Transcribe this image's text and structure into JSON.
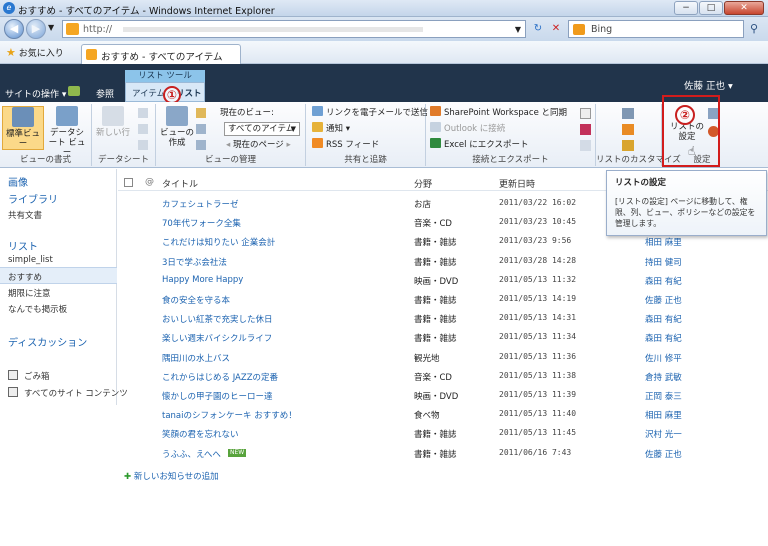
{
  "window": {
    "title": "おすすめ - すべてのアイテム - Windows Internet Explorer",
    "min": "−",
    "max": "□",
    "close": "✕"
  },
  "address": {
    "url": "http://",
    "refresh": "↻",
    "stop": "✕",
    "search_placeholder": "Bing"
  },
  "favorites": {
    "label": "お気に入り",
    "tab_title": "おすすめ - すべてのアイテム"
  },
  "sp": {
    "site_actions": "サイトの操作 ▾",
    "browse": "参照",
    "context_group": "リスト ツール",
    "tab_items": "アイテム",
    "tab_list": "リスト",
    "user": "佐藤 正也 ▾"
  },
  "ribbon": {
    "view_format": {
      "label": "ビューの書式",
      "standard": "標準ビュー",
      "datasheet": "データシート ビュー"
    },
    "datasheet": {
      "label": "データシート",
      "new_row": "新しい行"
    },
    "manage_views": {
      "label": "ビューの管理",
      "create": "ビューの 作成",
      "current_view": "現在のビュー:",
      "view_value": "すべてのアイテム",
      "current_page": "現在のページ"
    },
    "share": {
      "label": "共有と追跡",
      "email_link": "リンクを電子メールで送信",
      "alert": "通知",
      "rss": "RSS フィード"
    },
    "connect": {
      "label": "接続とエクスポート",
      "workspace": "SharePoint Workspace と同期",
      "outlook": "Outlook に接続",
      "excel": "Excel にエクスポート"
    },
    "customize": {
      "label": "リストのカスタマイズ"
    },
    "settings": {
      "label": "設定",
      "list_settings": "リストの 設定"
    }
  },
  "markers": {
    "one": "①",
    "two": "②"
  },
  "leftnav": {
    "pictures": "画像",
    "libraries": "ライブラリ",
    "shared_docs": "共有文書",
    "lists": "リスト",
    "simple_list": "simple_list",
    "osusume": "おすすめ",
    "kijitsu": "期限に注意",
    "keijiban": "なんでも掲示板",
    "discussion": "ディスカッション",
    "recycle": "ごみ箱",
    "all_content": "すべてのサイト コンテンツ"
  },
  "list": {
    "headers": {
      "title": "タイトル",
      "category": "分野",
      "modified": "更新日時"
    },
    "rows": [
      {
        "title": "カフェシュトラーゼ",
        "category": "お店",
        "date": "2011/03/22 16:02",
        "person": ""
      },
      {
        "title": "70年代フォーク全集",
        "category": "音楽・CD",
        "date": "2011/03/23 10:45",
        "person": ""
      },
      {
        "title": "これだけは知りたい 企業会計",
        "category": "書籍・雑誌",
        "date": "2011/03/23 9:56",
        "person": "相田 麻里"
      },
      {
        "title": "3日で学ぶ会社法",
        "category": "書籍・雑誌",
        "date": "2011/03/28 14:28",
        "person": "持田 健司"
      },
      {
        "title": "Happy More Happy",
        "category": "映画・DVD",
        "date": "2011/05/13 11:32",
        "person": "森田 有紀"
      },
      {
        "title": "食の安全を守る本",
        "category": "書籍・雑誌",
        "date": "2011/05/13 14:19",
        "person": "佐藤 正也"
      },
      {
        "title": "おいしい紅茶で充実した休日",
        "category": "書籍・雑誌",
        "date": "2011/05/13 14:31",
        "person": "森田 有紀"
      },
      {
        "title": "楽しい週末バイシクルライフ",
        "category": "書籍・雑誌",
        "date": "2011/05/13 11:34",
        "person": "森田 有紀"
      },
      {
        "title": "隅田川の水上バス",
        "category": "観光地",
        "date": "2011/05/13 11:36",
        "person": "佐川 修平"
      },
      {
        "title": "これからはじめる JAZZの定番",
        "category": "音楽・CD",
        "date": "2011/05/13 11:38",
        "person": "倉持 武敏"
      },
      {
        "title": "懐かしの甲子園のヒーロー達",
        "category": "映画・DVD",
        "date": "2011/05/13 11:39",
        "person": "正岡 泰三"
      },
      {
        "title": "tanaiのシフォンケーキ おすすめ！",
        "category": "食べ物",
        "date": "2011/05/13 11:40",
        "person": "相田 麻里"
      },
      {
        "title": "笑顔の君を忘れない",
        "category": "書籍・雑誌",
        "date": "2011/05/13 11:45",
        "person": "沢村 光一"
      },
      {
        "title": "うふふ、えへへ",
        "category": "書籍・雑誌",
        "date": "2011/06/16 7:43",
        "person": "佐藤 正也"
      }
    ],
    "new_badge": "NEW",
    "add_new": "新しいお知らせの追加"
  },
  "tooltip": {
    "title": "リストの設定",
    "body": "[リストの設定] ページに移動して、権限、列、ビュー、ポリシーなどの設定を管理します。"
  },
  "colors": {
    "accent": "#1c63b0",
    "highlight": "#d21c1c",
    "topbar": "#21344b"
  }
}
